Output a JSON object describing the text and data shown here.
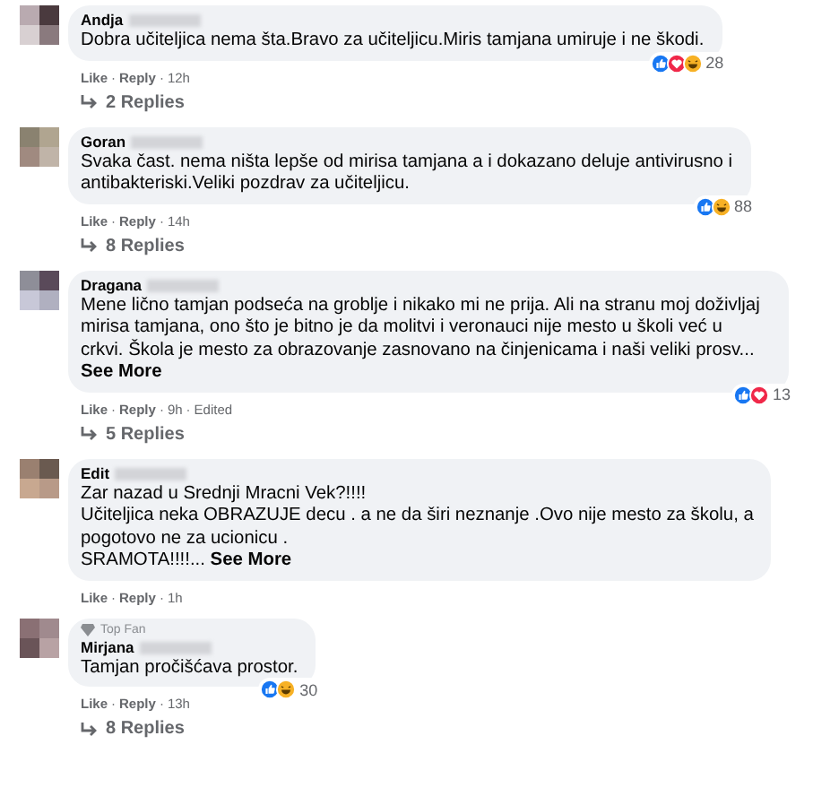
{
  "separator": "·",
  "comments": [
    {
      "name": "Andja",
      "lines": [
        "Dobra učiteljica nema šta.Bravo za učiteljicu.Miris tamjana umiruje i ne škodi."
      ],
      "reactions": [
        {
          "kind": "like"
        },
        {
          "kind": "love"
        },
        {
          "kind": "haha"
        }
      ],
      "reaction_count": "28",
      "actions": [
        "Like",
        "Reply"
      ],
      "time": "12h",
      "replies": "2 Replies"
    },
    {
      "name": "Goran",
      "lines": [
        "Svaka čast. nema ništa lepše od mirisa tamjana a i dokazano deluje antivirusno i",
        "antibakteriski.Veliki pozdrav za učiteljicu."
      ],
      "reactions": [
        {
          "kind": "like"
        },
        {
          "kind": "haha"
        }
      ],
      "reaction_count": "88",
      "actions": [
        "Like",
        "Reply"
      ],
      "time": "14h",
      "replies": "8 Replies"
    },
    {
      "name": "Dragana",
      "lines": [
        "Mene lično tamjan podseća na groblje i nikako mi ne prija. Ali na stranu moj doživljaj",
        "mirisa tamjana, ono što je bitno je da molitvi i veronauci nije mesto u školi već u",
        "crkvi. Škola je mesto za obrazovanje zasnovano na činjenicama i naši veliki prosv..."
      ],
      "see_more": "See More",
      "reactions": [
        {
          "kind": "like"
        },
        {
          "kind": "love"
        }
      ],
      "reaction_count": "13",
      "actions": [
        "Like",
        "Reply"
      ],
      "time": "9h",
      "edited": "Edited",
      "replies": "5 Replies"
    },
    {
      "name": "Edit",
      "lines": [
        "Zar nazad u Srednji Mracni Vek?!!!!",
        "Učiteljica neka OBRAZUJE decu . a ne da širi neznanje .Ovo nije mesto za školu, a",
        "pogotovo ne za ucionicu .",
        "SRAMOTA!!!!..."
      ],
      "see_more": "See More",
      "actions": [
        "Like",
        "Reply"
      ],
      "time": "1h"
    },
    {
      "name": "Mirjana",
      "badge": "Top Fan",
      "lines": [
        "Tamjan pročišćava prostor."
      ],
      "reactions": [
        {
          "kind": "like"
        },
        {
          "kind": "haha"
        }
      ],
      "reaction_count": "30",
      "actions": [
        "Like",
        "Reply"
      ],
      "time": "13h",
      "replies": "8 Replies"
    }
  ]
}
